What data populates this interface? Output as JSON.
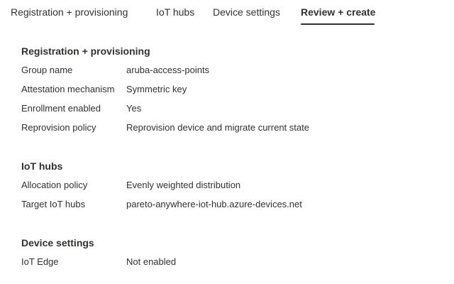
{
  "tabs": [
    {
      "label": "Registration + provisioning"
    },
    {
      "label": "IoT hubs"
    },
    {
      "label": "Device settings"
    },
    {
      "label": "Review + create",
      "active": true
    }
  ],
  "sections": [
    {
      "title": "Registration + provisioning",
      "rows": [
        {
          "label": "Group name",
          "value": "aruba-access-points"
        },
        {
          "label": "Attestation mechanism",
          "value": "Symmetric key"
        },
        {
          "label": "Enrollment enabled",
          "value": "Yes"
        },
        {
          "label": "Reprovision policy",
          "value": "Reprovision device and migrate current state"
        }
      ]
    },
    {
      "title": "IoT hubs",
      "rows": [
        {
          "label": "Allocation policy",
          "value": "Evenly weighted distribution"
        },
        {
          "label": "Target IoT hubs",
          "value": "pareto-anywhere-iot-hub.azure-devices.net"
        }
      ]
    },
    {
      "title": "Device settings",
      "rows": [
        {
          "label": "IoT Edge",
          "value": "Not enabled"
        }
      ]
    }
  ]
}
